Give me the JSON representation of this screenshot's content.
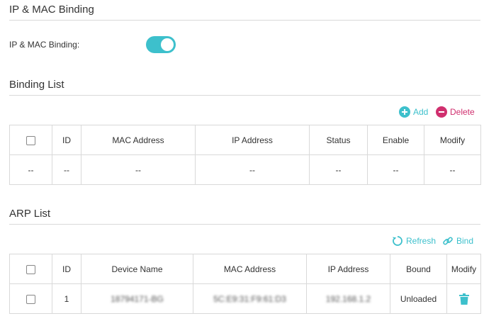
{
  "ip_mac_binding": {
    "title": "IP & MAC Binding",
    "toggle_label": "IP & MAC Binding:",
    "enabled": true
  },
  "binding_list": {
    "title": "Binding List",
    "add_label": "Add",
    "delete_label": "Delete",
    "columns": [
      "ID",
      "MAC Address",
      "IP Address",
      "Status",
      "Enable",
      "Modify"
    ],
    "row": [
      "--",
      "--",
      "--",
      "--",
      "--",
      "--",
      "--"
    ]
  },
  "arp_list": {
    "title": "ARP List",
    "refresh_label": "Refresh",
    "bind_label": "Bind",
    "columns": [
      "ID",
      "Device Name",
      "MAC Address",
      "IP Address",
      "Bound",
      "Modify"
    ],
    "rows": [
      {
        "id": "1",
        "device_name": "18794171-BG",
        "mac": "5C:E9:31:F9:61:D3",
        "ip": "192.168.1.2",
        "bound": "Unloaded"
      }
    ]
  },
  "icons": {
    "add": "plus-circle-icon",
    "delete": "minus-circle-icon",
    "refresh": "refresh-icon",
    "bind": "link-icon",
    "modify": "trash-icon"
  },
  "colors": {
    "accent": "#3dc0cc",
    "danger": "#d02f6e",
    "border": "#d9d9d9"
  }
}
